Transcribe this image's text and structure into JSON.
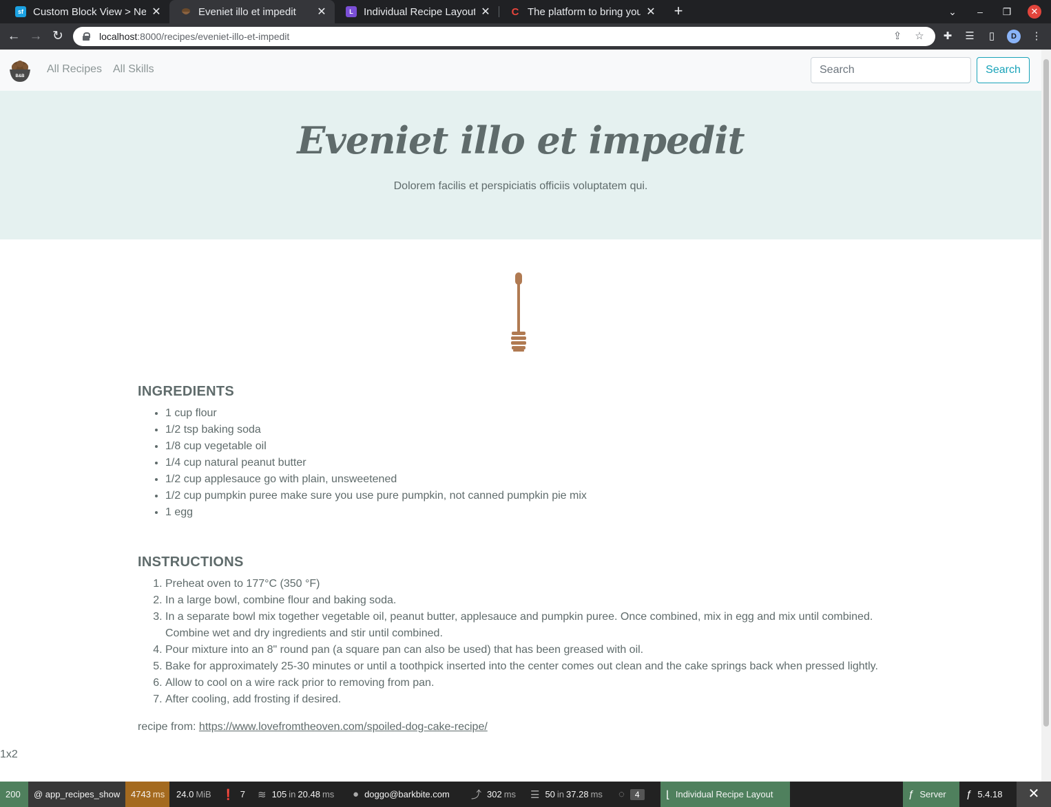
{
  "browser": {
    "tabs": [
      {
        "title": "Custom Block View > Netg",
        "favicon": "sf",
        "favicon_color": "#1ba1e2",
        "active": false
      },
      {
        "title": "Eveniet illo et impedit",
        "favicon": "bowl",
        "favicon_color": "#6b4a2b",
        "active": true
      },
      {
        "title": "Individual Recipe Layout -",
        "favicon": "L",
        "favicon_color": "#7b4fd6",
        "active": false
      },
      {
        "title": "The platform to bring you",
        "favicon": "C",
        "favicon_color": "#e8453c",
        "active": false
      }
    ],
    "url_host": "localhost",
    "url_path": ":8000/recipes/eveniet-illo-et-impedit",
    "profile_initial": "D"
  },
  "site": {
    "logo_text": "B&B",
    "nav": {
      "all_recipes": "All Recipes",
      "all_skills": "All Skills"
    },
    "search": {
      "placeholder": "Search",
      "button": "Search"
    }
  },
  "recipe": {
    "title": "Eveniet illo et impedit",
    "subtitle": "Dolorem facilis et perspiciatis officiis voluptatem qui.",
    "ingredients_heading": "INGREDIENTS",
    "ingredients": [
      "1 cup flour",
      "1/2 tsp baking soda",
      "1/8 cup vegetable oil",
      "1/4 cup natural peanut butter",
      "1/2 cup applesauce go with plain, unsweetened",
      "1/2 cup pumpkin puree make sure you use pure pumpkin, not canned pumpkin pie mix",
      "1 egg"
    ],
    "instructions_heading": "INSTRUCTIONS",
    "instructions": [
      "Preheat oven to 177°C (350 °F)",
      "In a large bowl, combine flour and baking soda.",
      "In a separate bowl mix together vegetable oil, peanut butter, applesauce and pumpkin puree. Once combined, mix in egg and mix until combined. Combine wet and dry ingredients and stir until combined.",
      "Pour mixture into an 8\" round pan (a square pan can also be used) that has been greased with oil.",
      "Bake for approximately 25-30 minutes or until a toothpick inserted into the center comes out clean and the cake springs back when pressed lightly.",
      "Allow to cool on a wire rack prior to removing from pan.",
      "After cooling, add frosting if desired."
    ],
    "source_label": "recipe from: ",
    "source_url": "https://www.lovefromtheoven.com/spoiled-dog-cake-recipe/",
    "stray_text": "1x2"
  },
  "toolbar": {
    "status": "200",
    "route": "@ app_recipes_show",
    "time": "4743",
    "time_unit": "ms",
    "memory": "24.0",
    "memory_unit": "MiB",
    "logs": "7",
    "cache_count": "105",
    "cache_in": "in",
    "cache_time": "20.48",
    "cache_unit": "ms",
    "user": "doggo@barkbite.com",
    "twig_time": "302",
    "twig_unit": "ms",
    "db_count": "50",
    "db_in": "in",
    "db_time": "37.28",
    "db_unit": "ms",
    "translations_count": "4",
    "layout": "Individual Recipe Layout",
    "server": "Server",
    "version": "5.4.18"
  },
  "colors": {
    "hero_bg": "#e5f1f0",
    "accent": "#17a2b8",
    "text": "#5f6b6b",
    "dipper": "#b07a52"
  }
}
